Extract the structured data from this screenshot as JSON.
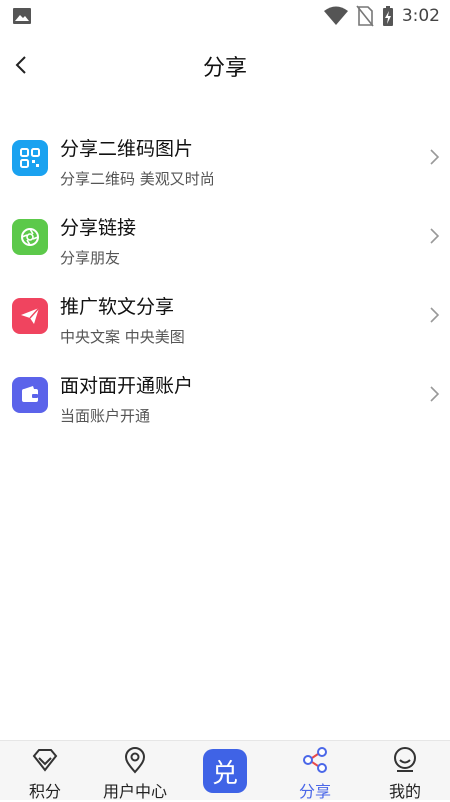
{
  "status_bar": {
    "time": "3:02",
    "icons": [
      "gallery-icon",
      "wifi-icon",
      "no-sim-icon",
      "battery-charging-icon"
    ]
  },
  "header": {
    "title": "分享",
    "back_icon": "chevron-left-icon"
  },
  "items": [
    {
      "title": "分享二维码图片",
      "subtitle": "分享二维码 美观又时尚",
      "icon": "qrcode-icon",
      "color": "#1aa2f0"
    },
    {
      "title": "分享链接",
      "subtitle": "分享朋友",
      "icon": "aperture-icon",
      "color": "#5cc94a"
    },
    {
      "title": "推广软文分享",
      "subtitle": "中央文案 中央美图",
      "icon": "paper-plane-icon",
      "color": "#f0445f"
    },
    {
      "title": "面对面开通账户",
      "subtitle": "当面账户开通",
      "icon": "wallet-icon",
      "color": "#5b63ea"
    }
  ],
  "bottom_nav": {
    "items": [
      {
        "label": "积分",
        "icon": "diamond-icon"
      },
      {
        "label": "用户中心",
        "icon": "location-pin-icon"
      },
      {
        "label": "分享",
        "icon": "share-icon",
        "active": true
      },
      {
        "label": "我的",
        "icon": "smiley-icon"
      }
    ],
    "center_button": "兑",
    "active_color": "#4a67e8"
  }
}
